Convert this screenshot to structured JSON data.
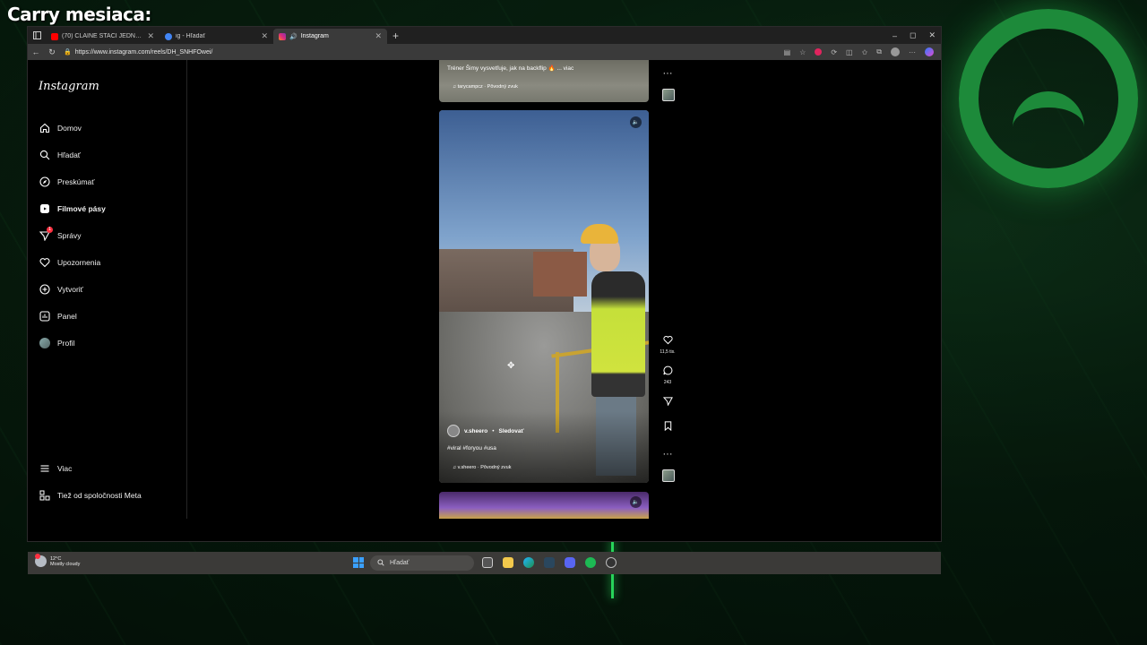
{
  "overlay": {
    "title": "Carry mesiaca:"
  },
  "browser": {
    "tabs": [
      {
        "label": "(70) CLAINĚ STAČÍ JEDNA MYŠLE...",
        "favicon_color": "#ff0000"
      },
      {
        "label": "ig - Hľadať",
        "favicon_color": "#4285f4"
      },
      {
        "label": "Instagram",
        "favicon_color": "#e1306c"
      }
    ],
    "url": "https://www.instagram.com/reels/DH_SNHFOwei/",
    "window_controls": [
      "–",
      "◻",
      "✕"
    ]
  },
  "instagram": {
    "logo": "Instagram",
    "nav": [
      {
        "id": "home",
        "label": "Domov",
        "icon": "home-icon"
      },
      {
        "id": "search",
        "label": "Hľadať",
        "icon": "search-icon"
      },
      {
        "id": "explore",
        "label": "Preskúmať",
        "icon": "compass-icon"
      },
      {
        "id": "reels",
        "label": "Filmové pásy",
        "icon": "reels-icon",
        "active": true
      },
      {
        "id": "messages",
        "label": "Správy",
        "icon": "send-icon",
        "badge": "1"
      },
      {
        "id": "notifications",
        "label": "Upozornenia",
        "icon": "heart-icon"
      },
      {
        "id": "create",
        "label": "Vytvoriť",
        "icon": "plus-square-icon"
      },
      {
        "id": "dashboard",
        "label": "Panel",
        "icon": "chart-icon"
      },
      {
        "id": "profile",
        "label": "Profil",
        "icon": "avatar"
      }
    ],
    "nav_bottom": [
      {
        "id": "more",
        "label": "Viac",
        "icon": "menu-icon"
      },
      {
        "id": "meta",
        "label": "Tiež od spoločnosti Meta",
        "icon": "meta-icon"
      }
    ],
    "reel_prev": {
      "caption": "Tréner Šimy vysvetľuje, jak na backflip 🔥 ... viac",
      "audio": "tarycampcz · Pôvodný zvuk"
    },
    "reel": {
      "username": "v.sheero",
      "follow": "Sledovať",
      "tags": "#viral #foryou #usa",
      "audio": "v.sheero · Pôvodný zvuk",
      "likes": "11,5 tis.",
      "comments": "243",
      "more": "···"
    }
  },
  "taskbar": {
    "temperature": "12°C",
    "weather": "Mostly cloudy",
    "search_placeholder": "Hľadať"
  }
}
